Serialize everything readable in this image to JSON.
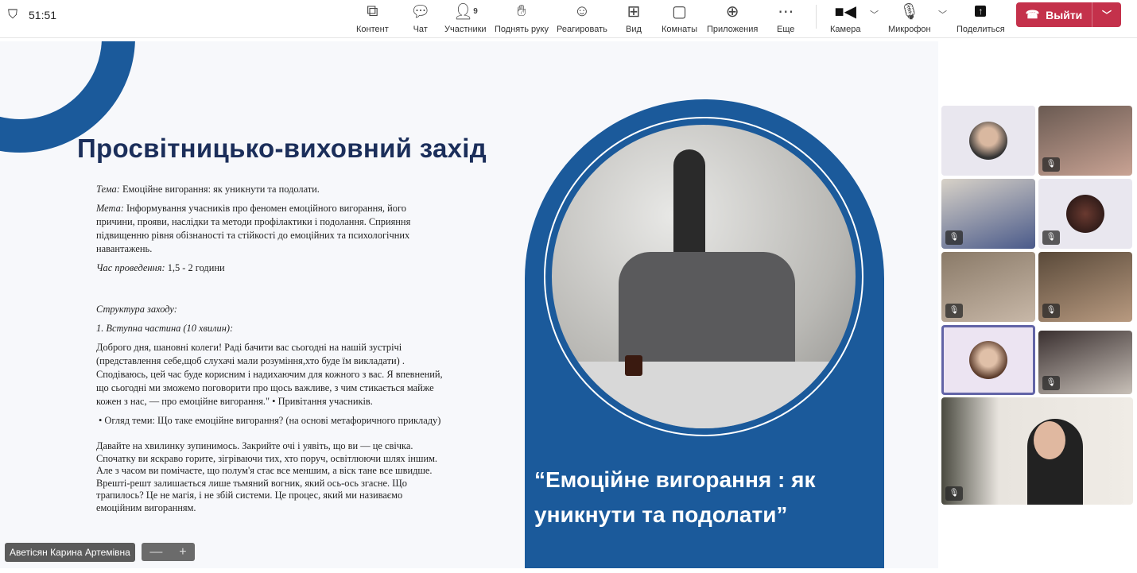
{
  "topbar": {
    "timer": "51:51",
    "participants_count": "9",
    "buttons": [
      {
        "label": "Контент",
        "icon": "share-content-icon"
      },
      {
        "label": "Чат",
        "icon": "chat-icon"
      },
      {
        "label": "Участники",
        "icon": "people-icon"
      },
      {
        "label": "Поднять руку",
        "icon": "raise-hand-icon"
      },
      {
        "label": "Реагировать",
        "icon": "smile-icon"
      },
      {
        "label": "Вид",
        "icon": "grid-icon"
      },
      {
        "label": "Комнаты",
        "icon": "rooms-icon"
      },
      {
        "label": "Приложения",
        "icon": "add-app-icon"
      },
      {
        "label": "Еще",
        "icon": "more-icon"
      },
      {
        "label": "Камера",
        "icon": "camera-icon"
      },
      {
        "label": "Микрофон",
        "icon": "mic-off-icon"
      },
      {
        "label": "Поделиться",
        "icon": "share-icon"
      }
    ],
    "leave_label": "Выйти",
    "leave_color": "#c4314b"
  },
  "slide": {
    "title": "Просвітницько-виховний  захід",
    "tema_label": "Тема:",
    "tema": "Емоційне вигорання: як уникнути та подолати.",
    "meta_label": "Мета:",
    "meta": "Інформування учасників про феномен емоційного вигорання, його причини, прояви, наслідки та методи профілактики і подолання. Сприяння підвищенню рівня обізнаності та стійкості до емоційних та психологічних навантажень.",
    "time_label": "Час проведення:",
    "time": "1,5 - 2 години",
    "structure": "Структура заходу:",
    "part1": "1. Вступна частина (10  хвилин):",
    "greeting": "Доброго дня, шановні колеги! Раді бачити вас сьогодні на нашій зустрічі (представлення себе,щоб слухачі мали розуміння,хто буде їм викладати) . Сподіваюсь, цей час буде корисним і надихаючим для кожного з вас. Я впевнений, що сьогодні ми зможемо поговорити про щось важливе, з чим стикається майже кожен з нас, — про емоційне вигорання.\" • Привітання учасників.",
    "overview": "• Огляд теми: Що таке емоційне вигорання? (на основі метафоричного прикладу)",
    "candle": "Давайте на хвилинку зупинимось. Закрийте очі і уявіть, що ви — це свічка. Спочатку ви яскраво горите, зігріваючи тих, хто поруч, освітлюючи шлях іншим. Але з часом ви помічаєте, що полум'я стає все меншим, а віск тане все швидше. Врешті-решт залишається лише тьмяний вогник, який ось-ось згасне. Що трапилось? Це не магія, і не збій системи. Це процес, який ми називаємо емоційним вигоранням.",
    "quote": "“Емоційне вигорання : як уникнути та подолати”",
    "accent": "#1b5a9b"
  },
  "presenter_name": "Аветісян Карина Артемівна",
  "zoom_controls": {
    "minus": "—",
    "plus": "+"
  }
}
